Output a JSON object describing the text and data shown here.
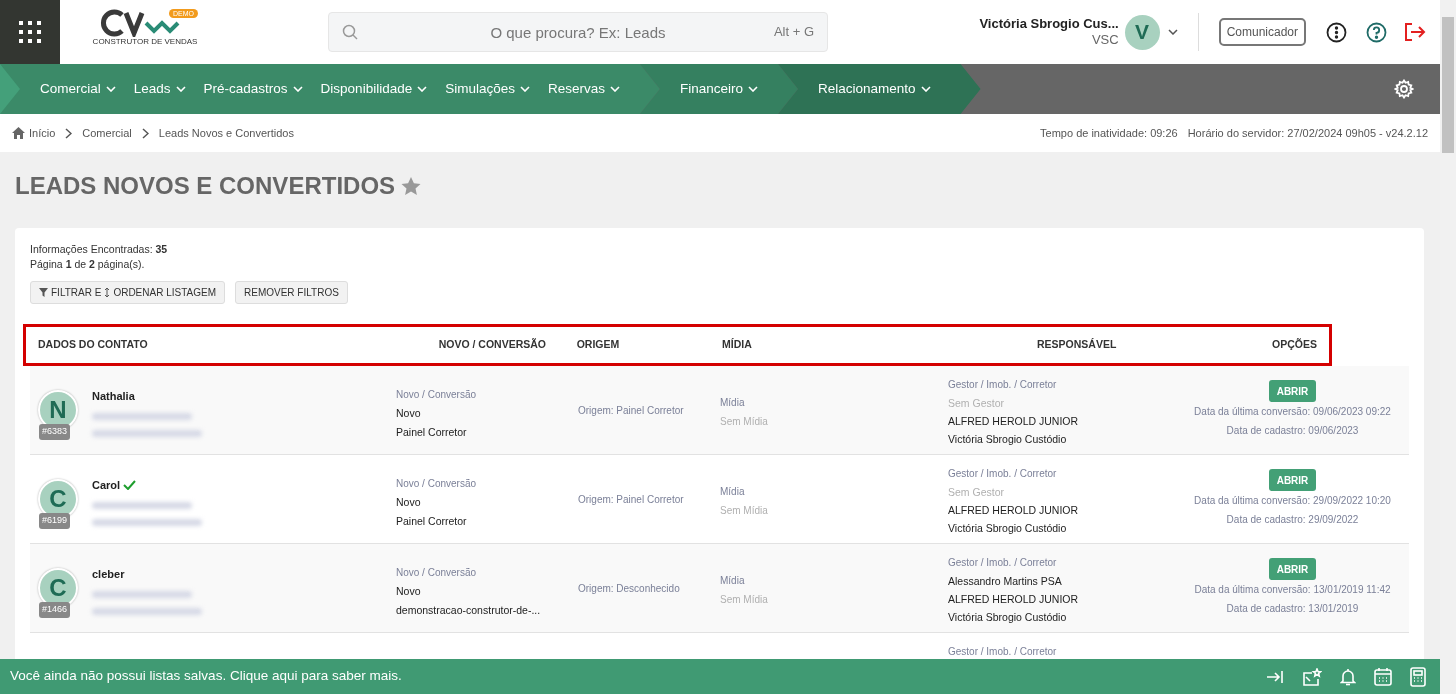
{
  "header": {
    "logo_text": "CONSTRUTOR DE VENDAS",
    "logo_badge": "DEMO",
    "search": {
      "placeholder": "O que procura? Ex: Leads",
      "shortcut": "Alt + G"
    },
    "user": {
      "name": "Victória Sbrogio Cus...",
      "code": "VSC",
      "initial": "V"
    },
    "communicator": "Comunicador"
  },
  "nav": [
    {
      "items": [
        "Comercial",
        "Leads",
        "Pré-cadastros",
        "Disponibilidade",
        "Simulações",
        "Reservas"
      ]
    },
    {
      "items": [
        "Financeiro"
      ]
    },
    {
      "items": [
        "Relacionamento"
      ]
    }
  ],
  "breadcrumb": [
    "Início",
    "Comercial",
    "Leads Novos e Convertidos"
  ],
  "status": [
    "Tempo de inatividade: 09:26",
    "Horário do servidor: 27/02/2024 09h05 - v24.2.12"
  ],
  "page_title": "LEADS NOVOS E CONVERTIDOS",
  "summary": [
    "Informações Encontradas: **35**",
    "Página **1** de **2** página(s)."
  ],
  "filter_button": [
    "FILTRAR E",
    "ORDENAR LISTAGEM"
  ],
  "remove_button": "REMOVER FILTROS",
  "columns": [
    "DADOS DO CONTATO",
    "NOVO / CONVERSÃO",
    "ORIGEM",
    "MÍDIA",
    "RESPONSÁVEL",
    "OPÇÕES"
  ],
  "rows": [
    {
      "initial": "N",
      "name": "Nathalia",
      "verified": false,
      "id": "#6383",
      "novo_label": "Novo / Conversão",
      "novo": [
        "Novo",
        "Painel Corretor"
      ],
      "origem": "Origem: Painel Corretor",
      "midia_label": "Mídia",
      "midia": "Sem Mídia",
      "resp_label": "Gestor / Imob. / Corretor",
      "resp": [
        {
          "text": "Sem Gestor",
          "muted": true
        },
        {
          "text": "ALFRED HEROLD JUNIOR",
          "muted": false
        },
        {
          "text": "Victória Sbrogio Custódio",
          "muted": false
        }
      ],
      "button": "ABRIR",
      "dates": [
        "Data da última conversão: 09/06/2023 09:22",
        "Data de cadastro: 09/06/2023"
      ]
    },
    {
      "initial": "C",
      "name": "Carol",
      "verified": true,
      "id": "#6199",
      "novo_label": "Novo / Conversão",
      "novo": [
        "Novo",
        "Painel Corretor"
      ],
      "origem": "Origem: Painel Corretor",
      "midia_label": "Mídia",
      "midia": "Sem Mídia",
      "resp_label": "Gestor / Imob. / Corretor",
      "resp": [
        {
          "text": "Sem Gestor",
          "muted": true
        },
        {
          "text": "ALFRED HEROLD JUNIOR",
          "muted": false
        },
        {
          "text": "Victória Sbrogio Custódio",
          "muted": false
        }
      ],
      "button": "ABRIR",
      "dates": [
        "Data da última conversão: 29/09/2022 10:20",
        "Data de cadastro: 29/09/2022"
      ]
    },
    {
      "initial": "C",
      "name": "cleber",
      "verified": false,
      "id": "#1466",
      "novo_label": "Novo / Conversão",
      "novo": [
        "Novo",
        "demonstracao-construtor-de-..."
      ],
      "origem": "Origem: Desconhecido",
      "midia_label": "Mídia",
      "midia": "Sem Mídia",
      "resp_label": "Gestor / Imob. / Corretor",
      "resp": [
        {
          "text": "Alessandro Martins PSA",
          "muted": false
        },
        {
          "text": "ALFRED HEROLD JUNIOR",
          "muted": false
        },
        {
          "text": "Victória Sbrogio Custódio",
          "muted": false
        }
      ],
      "button": "ABRIR",
      "dates": [
        "Data da última conversão: 13/01/2019 11:42",
        "Data de cadastro: 13/01/2019"
      ]
    },
    {
      "resp_label": "Gestor / Imob. / Corretor"
    }
  ],
  "bottom_bar": "Você ainda não possui listas salvas. Clique aqui para saber mais."
}
